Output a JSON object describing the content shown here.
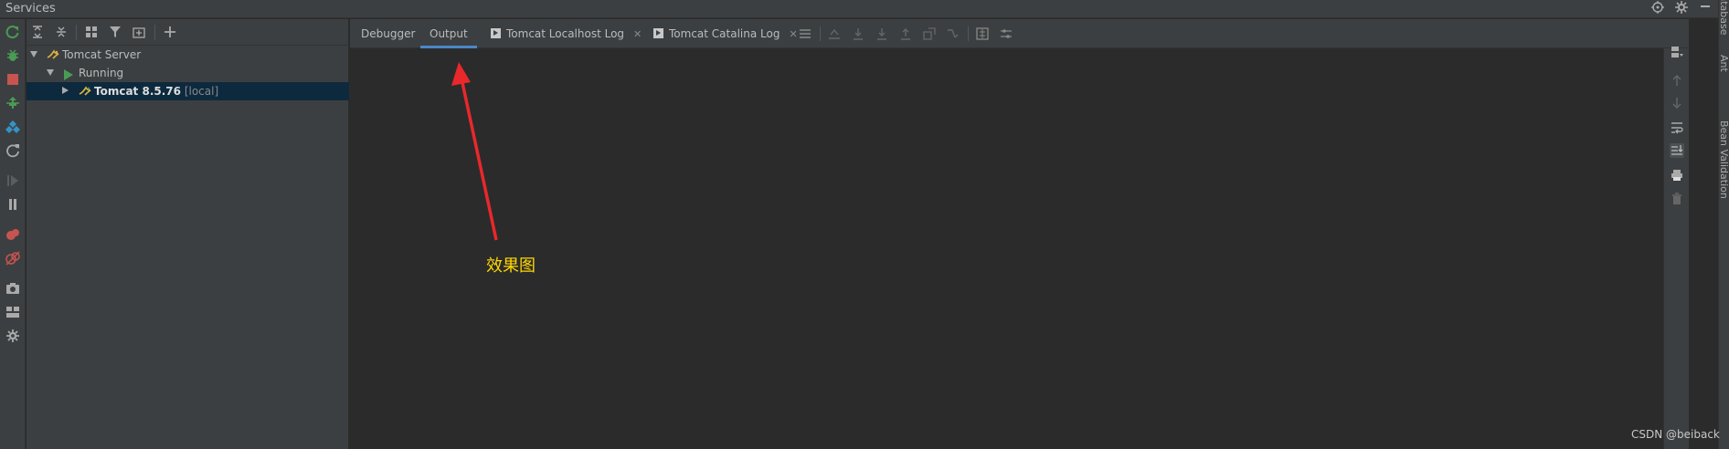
{
  "window": {
    "title": "Services"
  },
  "side_tools": {
    "database": "Database",
    "ant": "Ant",
    "bean_validation": "Bean Validation"
  },
  "tree": {
    "items": [
      {
        "label": "Tomcat Server",
        "level": 0,
        "expanded": true
      },
      {
        "label": "Running",
        "level": 1,
        "expanded": true
      },
      {
        "label": "Tomcat 8.5.76",
        "suffix": "[local]",
        "level": 2,
        "expanded": false,
        "selected": true
      }
    ]
  },
  "tabs": [
    {
      "label": "Debugger",
      "active": false,
      "closable": false
    },
    {
      "label": "Output",
      "active": true,
      "closable": false
    },
    {
      "label": "Tomcat Localhost Log",
      "active": false,
      "closable": true
    },
    {
      "label": "Tomcat Catalina Log",
      "active": false,
      "closable": true
    }
  ],
  "annotation": {
    "text": "效果图"
  },
  "watermark": {
    "text": "CSDN @beiback"
  },
  "colors": {
    "accent": "#4a88c7",
    "annotation": "#ffd800",
    "arrow": "#e8282b",
    "run_green": "#499c54",
    "stop_red": "#c75450"
  }
}
